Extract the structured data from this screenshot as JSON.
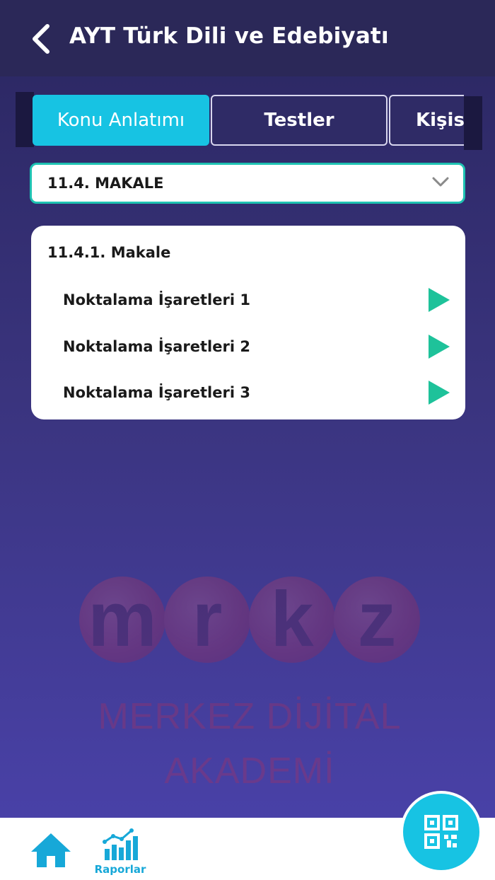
{
  "header": {
    "title": "AYT Türk Dili ve Edebiyatı",
    "back_icon": "chevron-left-icon"
  },
  "tabs": [
    {
      "label": "Konu Anlatımı",
      "active": true
    },
    {
      "label": "Testler",
      "active": false
    },
    {
      "label": "Kişise",
      "active": false
    }
  ],
  "dropdown": {
    "value": "11.4. MAKALE",
    "icon": "chevron-down-icon"
  },
  "card": {
    "title": "11.4.1. Makale",
    "lessons": [
      {
        "label": "Noktalama İşaretleri 1"
      },
      {
        "label": "Noktalama İşaretleri 2"
      },
      {
        "label": "Noktalama İşaretleri 3"
      }
    ]
  },
  "watermark": {
    "letters": [
      "m",
      "r",
      "k",
      "z"
    ],
    "line1": "MERKEZ DİJİTAL",
    "line2": "AKADEMİ"
  },
  "bottom_nav": {
    "home_icon": "home-icon",
    "reports_label": "Raporlar",
    "reports_icon": "bar-chart-icon",
    "qr_icon": "qr-code-icon"
  },
  "colors": {
    "accent": "#17c3e3",
    "play": "#1ec29a",
    "header_bg": "#2b2858",
    "dropdown_border": "#1ec2b2"
  }
}
